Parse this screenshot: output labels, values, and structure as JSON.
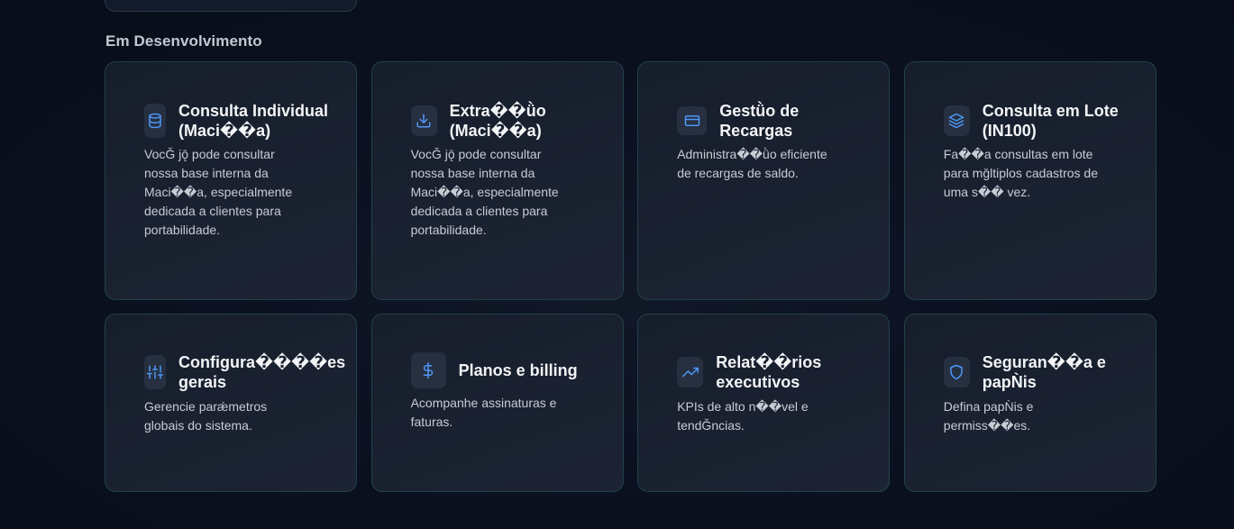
{
  "section": {
    "title": "Em Desenvolvimento"
  },
  "cards": [
    {
      "title": "Consulta Individual (Maci��a)",
      "description": "VocǦ jǭ pode consultar nossa base interna da Maci��a, especialmente dedicada a clientes para portabilidade.",
      "icon": "database-icon"
    },
    {
      "title": "Extra��ǜo (Maci��a)",
      "description": "VocǦ jǭ pode consultar nossa base interna da Maci��a, especialmente dedicada a clientes para portabilidade.",
      "icon": "download-icon"
    },
    {
      "title": "Gestǜo de Recargas",
      "description": "Administra��ǜo eficiente de recargas de saldo.",
      "icon": "credit-card-icon"
    },
    {
      "title": "Consulta em Lote (IN100)",
      "description": "Fa��a consultas em lote para mǧltiplos cadastros de uma s�� vez.",
      "icon": "layers-icon"
    },
    {
      "title": "Configura����es gerais",
      "description": "Gerencie parǽmetros globais do sistema.",
      "icon": "sliders-icon"
    },
    {
      "title": "Planos e billing",
      "description": "Acompanhe assinaturas e faturas.",
      "icon": "dollar-icon"
    },
    {
      "title": "Relat��rios executivos",
      "description": "KPIs de alto n��vel e tendǦncias.",
      "icon": "trending-up-icon"
    },
    {
      "title": "Seguran��a e papǸis",
      "description": "Defina papǸis e permiss��es.",
      "icon": "shield-icon"
    }
  ],
  "colors": {
    "background": "#0b1120",
    "card_background": "#1a2130",
    "card_border": "#23404c",
    "icon_accent": "#4f97f6",
    "title_text": "#f3f4f6",
    "body_text": "#c8ccd4"
  }
}
